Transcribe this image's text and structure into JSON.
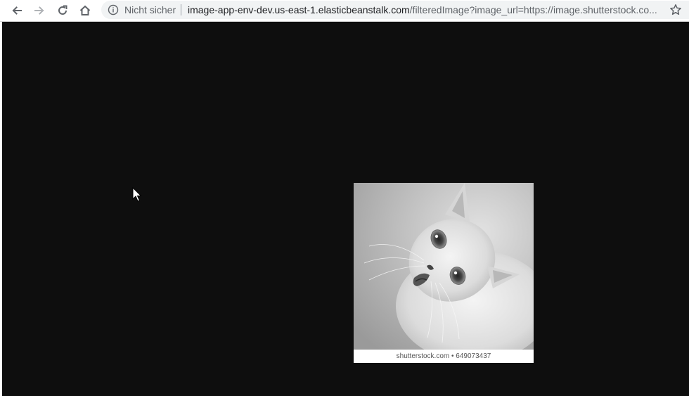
{
  "browser": {
    "nav": {
      "back_icon": "arrow-left-icon",
      "forward_icon": "arrow-right-icon",
      "reload_icon": "reload-icon",
      "home_icon": "home-icon"
    },
    "omnibox": {
      "security_icon": "info-icon",
      "security_label": "Nicht sicher",
      "url_host": "image-app-env-dev.us-east-1.elasticbeanstalk.com",
      "url_path": "/filteredImage?image_url=https://image.shutterstock.co...",
      "bookmark_icon": "star-icon"
    }
  },
  "page": {
    "background_color": "#0e0e0e",
    "image": {
      "subject": "grayscale-kitten-photo",
      "watermark": "shutterstock.com • 649073437"
    }
  }
}
